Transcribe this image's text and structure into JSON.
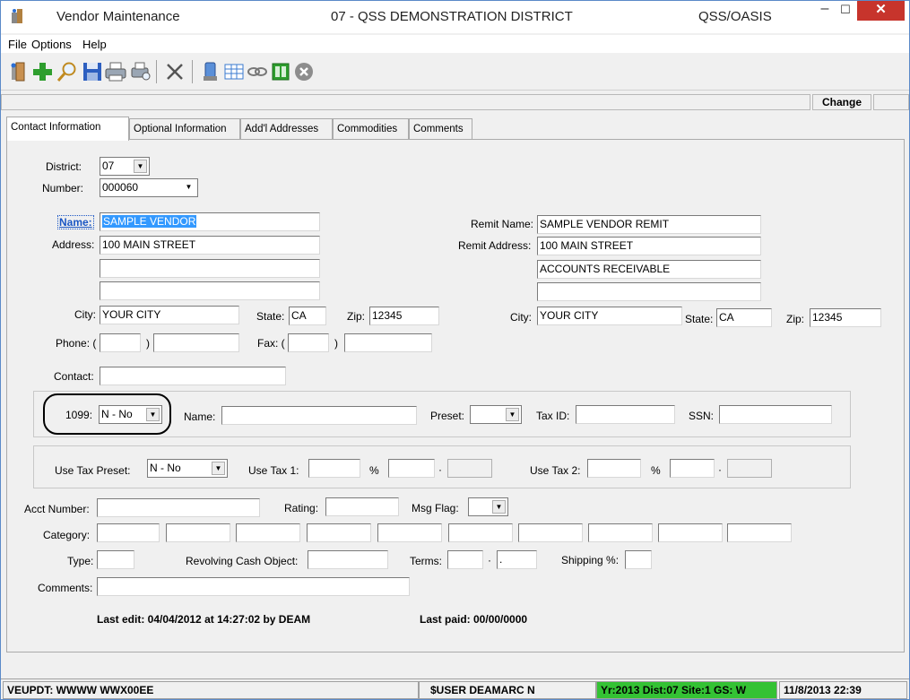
{
  "window": {
    "title": "Vendor Maintenance",
    "district_title": "07 - QSS DEMONSTRATION DISTRICT",
    "app_name": "QSS/OASIS",
    "minimize": "–",
    "maximize": "☐",
    "close": "✕"
  },
  "menu": {
    "file": "File",
    "options": "Options",
    "help": "Help"
  },
  "toolbar": {
    "icons": [
      "exit-icon",
      "add-icon",
      "search-icon",
      "save-icon",
      "print-icon",
      "print-preview-icon",
      "delete-icon",
      "phone-icon",
      "grid-icon",
      "link-icon",
      "columns-icon",
      "cancel-icon"
    ]
  },
  "mode": {
    "label": "Change"
  },
  "tabs": {
    "contact": "Contact Information",
    "optional": "Optional Information",
    "addl": "Add'l Addresses",
    "commodities": "Commodities",
    "comments": "Comments"
  },
  "form": {
    "district_label": "District:",
    "district_value": "07",
    "number_label": "Number:",
    "number_value": "000060",
    "name_label": "Name:",
    "name_value": "SAMPLE VENDOR",
    "address_label": "Address:",
    "address1": "100 MAIN STREET",
    "address2": "",
    "address3": "",
    "city_label": "City:",
    "city_value": "YOUR CITY",
    "state_label": "State:",
    "state_value": "CA",
    "zip_label": "Zip:",
    "zip_value": "12345",
    "phone_label": "Phone: (",
    "phone_area": "",
    "phone_close": ")",
    "phone_number": "",
    "fax_label": "Fax: (",
    "fax_area": "",
    "fax_close": ")",
    "fax_number": "",
    "contact_label": "Contact:",
    "contact_value": "",
    "remit_name_label": "Remit Name:",
    "remit_name_value": "SAMPLE VENDOR REMIT",
    "remit_address_label": "Remit Address:",
    "remit_address1": "100 MAIN STREET",
    "remit_address2": "ACCOUNTS RECEIVABLE",
    "remit_address3": "",
    "remit_city_label": "City:",
    "remit_city_value": "YOUR CITY",
    "remit_state_label": "State:",
    "remit_state_value": "CA",
    "remit_zip_label": "Zip:",
    "remit_zip_value": "12345",
    "t1099_label": "1099:",
    "t1099_value": "N - No",
    "t1099_name_label": "Name:",
    "preset_label": "Preset:",
    "taxid_label": "Tax ID:",
    "ssn_label": "SSN:",
    "use_tax_preset_label": "Use Tax Preset:",
    "use_tax_preset_value": "N - No",
    "use_tax1_label": "Use Tax 1:",
    "use_tax2_label": "Use Tax 2:",
    "pct": "%",
    "dot": "·",
    "acct_label": "Acct Number:",
    "rating_label": "Rating:",
    "msg_flag_label": "Msg Flag:",
    "category_label": "Category:",
    "type_label": "Type:",
    "revolving_label": "Revolving Cash Object:",
    "terms_label": "Terms:",
    "terms_dot": "·",
    "terms_value2": ".",
    "shipping_label": "Shipping %:",
    "comments_label": "Comments:",
    "last_edit": "Last edit: 04/04/2012 at 14:27:02 by DEAM",
    "last_paid": "Last paid: 00/00/0000"
  },
  "status": {
    "left": "VEUPDT: WWWW WWX00EE",
    "user": "$USER   DEAMARC N",
    "context": "Yr:2013  Dist:07  Site:1  GS: W",
    "datetime": "11/8/2013  22:39"
  },
  "colors": {
    "accent": "#3399ff",
    "status_green": "#34c234",
    "close_red": "#c7342c",
    "highlight_ring": "#000000"
  }
}
